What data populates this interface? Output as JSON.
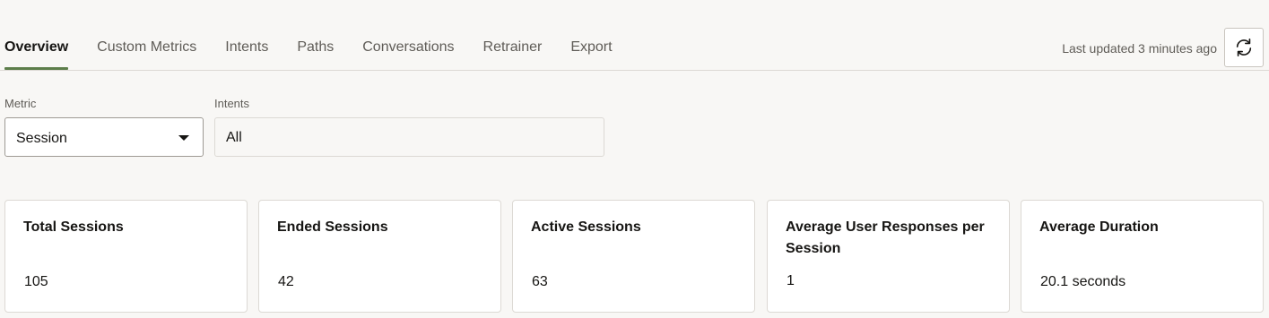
{
  "tabs": [
    {
      "label": "Overview",
      "active": true
    },
    {
      "label": "Custom Metrics"
    },
    {
      "label": "Intents"
    },
    {
      "label": "Paths"
    },
    {
      "label": "Conversations"
    },
    {
      "label": "Retrainer"
    },
    {
      "label": "Export"
    }
  ],
  "header": {
    "last_updated": "Last updated 3 minutes ago",
    "refresh_icon": "refresh-icon"
  },
  "filters": {
    "metric_label": "Metric",
    "metric_value": "Session",
    "intents_label": "Intents",
    "intents_value": "All"
  },
  "cards": [
    {
      "title": "Total Sessions",
      "value": "105"
    },
    {
      "title": "Ended Sessions",
      "value": "42"
    },
    {
      "title": "Active Sessions",
      "value": "63"
    },
    {
      "title": "Average User Responses per Session",
      "value": "1"
    },
    {
      "title": "Average Duration",
      "value": "20.1 seconds"
    }
  ],
  "colors": {
    "accent": "#5c7d4a",
    "background": "#f8f7f5"
  }
}
